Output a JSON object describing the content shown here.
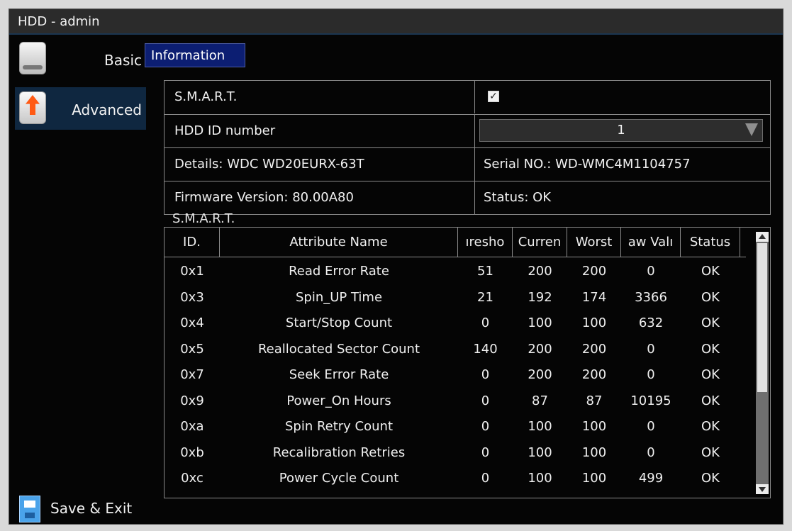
{
  "window": {
    "title": "HDD - admin"
  },
  "sidebar": {
    "items": [
      {
        "label": "Basic",
        "icon": "hard-drive-icon"
      },
      {
        "label": "Advanced",
        "icon": "upgrade-arrow-icon"
      }
    ],
    "save_exit": {
      "label": "Save & Exit",
      "icon": "floppy-disk-icon"
    }
  },
  "tab": {
    "label": "Information"
  },
  "info": {
    "smart_label": "S.M.A.R.T.",
    "smart_checked": true,
    "hdd_id_label": "HDD ID number",
    "hdd_id_value": "1",
    "details": "Details: WDC WD20EURX-63T",
    "serial": "Serial NO.: WD-WMC4M1104757",
    "firmware": "Firmware Version: 80.00A80",
    "status": "Status: OK"
  },
  "smart_section": {
    "label": "S.M.A.R.T."
  },
  "smart_table": {
    "headers": [
      "ID.",
      "Attribute Name",
      "Threshold",
      "Current",
      "Worst",
      "Raw Value",
      "Status"
    ],
    "header_visible": [
      "ID.",
      "Attribute Name",
      "ıresho",
      "Curren",
      "Worst",
      "aw Valı",
      "Status"
    ],
    "rows": [
      [
        "0x1",
        "Read Error Rate",
        "51",
        "200",
        "200",
        "0",
        "OK"
      ],
      [
        "0x3",
        "Spin_UP Time",
        "21",
        "192",
        "174",
        "3366",
        "OK"
      ],
      [
        "0x4",
        "Start/Stop Count",
        "0",
        "100",
        "100",
        "632",
        "OK"
      ],
      [
        "0x5",
        "Reallocated Sector Count",
        "140",
        "200",
        "200",
        "0",
        "OK"
      ],
      [
        "0x7",
        "Seek Error Rate",
        "0",
        "200",
        "200",
        "0",
        "OK"
      ],
      [
        "0x9",
        "Power_On Hours",
        "0",
        "87",
        "87",
        "10195",
        "OK"
      ],
      [
        "0xa",
        "Spin Retry Count",
        "0",
        "100",
        "100",
        "0",
        "OK"
      ],
      [
        "0xb",
        "Recalibration Retries",
        "0",
        "100",
        "100",
        "0",
        "OK"
      ],
      [
        "0xc",
        "Power Cycle Count",
        "0",
        "100",
        "100",
        "499",
        "OK"
      ]
    ]
  },
  "colors": {
    "accent": "#0c1e72",
    "selected": "#0f2740",
    "border": "#8a8a8a"
  }
}
